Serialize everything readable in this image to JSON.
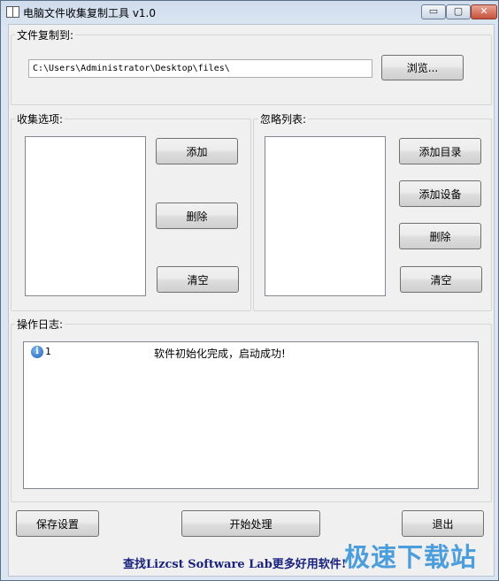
{
  "window": {
    "title": "电脑文件收集复制工具 v1.0",
    "controls": {
      "minimize": "▭",
      "maximize": "▢",
      "close": "✕"
    }
  },
  "copy_to": {
    "label": "文件复制到:",
    "path_value": "C:\\Users\\Administrator\\Desktop\\files\\",
    "browse_label": "浏览..."
  },
  "collect_options": {
    "label": "收集选项:",
    "add_label": "添加",
    "delete_label": "删除",
    "clear_label": "清空"
  },
  "ignore_list": {
    "label": "忽略列表:",
    "add_dir_label": "添加目录",
    "add_device_label": "添加设备",
    "delete_label": "删除",
    "clear_label": "清空"
  },
  "log": {
    "label": "操作日志:",
    "entries": [
      {
        "icon": "info-icon",
        "index": "1",
        "message": "软件初始化完成，启动成功!"
      }
    ]
  },
  "actions": {
    "save_label": "保存设置",
    "start_label": "开始处理",
    "exit_label": "退出"
  },
  "footer": {
    "link_text": "查找Lizcst Software Lab更多好用软件!",
    "watermark_text": "极速下载站"
  },
  "colors": {
    "link": "#1a237e",
    "watermark": "#2f8fd9",
    "titlebar": "#dce6f2"
  }
}
